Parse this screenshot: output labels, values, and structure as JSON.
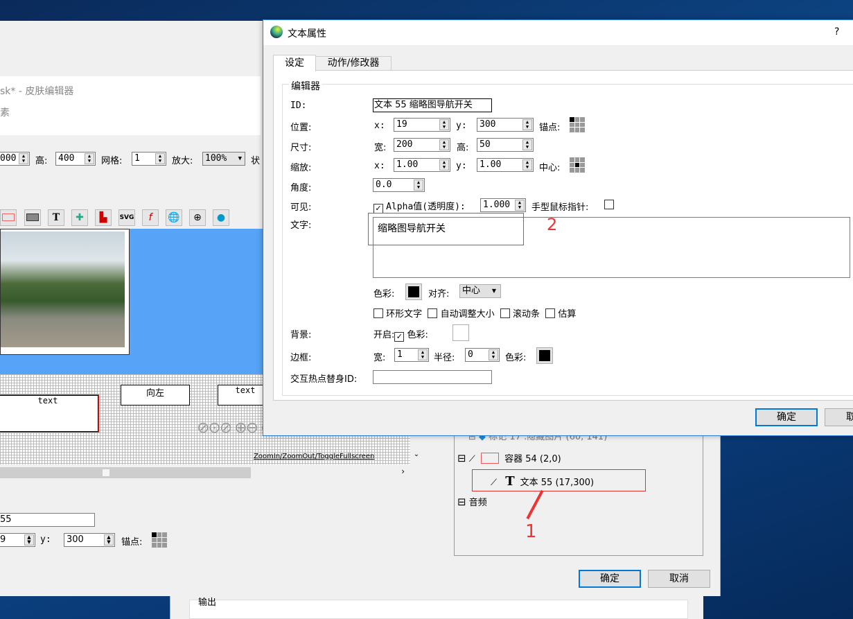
{
  "editor": {
    "title": "sk* - 皮肤编辑器",
    "subtitle": "素",
    "toolbar": {
      "width_value": "000",
      "height_label": "高:",
      "height_value": "400",
      "grid_label": "网格:",
      "grid_value": "1",
      "zoom_label": "放大:",
      "zoom_value": "100%",
      "status_label": "状"
    },
    "tool_icons": [
      "rectangle-icon",
      "filled-rectangle-icon",
      "text-icon",
      "image-button-icon",
      "image-icon",
      "svg-icon",
      "flash-icon",
      "globe-icon",
      "crosshair-icon",
      "map-pin-icon"
    ],
    "tool_text_icon": "T",
    "canvas": {
      "text_box_1": "text",
      "button_left": "向左",
      "text_box_2": "text",
      "footer_text": "ZoomIn/ZoomOut/ToggleFullscreen"
    },
    "lower": {
      "id_value": "55",
      "x_value": "9",
      "y_label": "y:",
      "y_value": "300",
      "anchor_label": "锚点:"
    },
    "tree": {
      "items": [
        {
          "label": "标记 17 :隐藏图片 (60, 141)"
        },
        {
          "label": "容器 54 (2,0)"
        },
        {
          "label": "文本 55 (17,300)"
        },
        {
          "label": "音频"
        }
      ]
    },
    "ok": "确定",
    "cancel": "取消",
    "output_label": "输出",
    "annotation_1": "1"
  },
  "dialog": {
    "title": "文本属性",
    "help": "?",
    "tabs": [
      {
        "label": "设定"
      },
      {
        "label": "动作/修改器"
      }
    ],
    "group": "编辑器",
    "id_label": "ID:",
    "id_value": "文本 55 缩略图导航开关",
    "pos_label": "位置:",
    "x_label": "x:",
    "x_value": "19",
    "y_label": "y:",
    "y_value": "300",
    "anchor_label": "锚点:",
    "size_label": "尺寸:",
    "w_label": "宽:",
    "w_value": "200",
    "h_label": "高:",
    "h_value": "50",
    "scale_label": "缩放:",
    "sx_value": "1.00",
    "sy_value": "1.00",
    "center_label": "中心:",
    "angle_label": "角度:",
    "angle_value": "0.0",
    "visible_label": "可见:",
    "alpha_label": "Alpha值(透明度):",
    "alpha_value": "1.000",
    "hand_label": "手型鼠标指针:",
    "visible_checked": true,
    "hand_checked": false,
    "text_label": "文字:",
    "text_value": "缩略图导航开关",
    "annotation_2": "2",
    "color_label": "色彩:",
    "text_color": "#000000",
    "align_label": "对齐:",
    "align_value": "中心",
    "options": [
      {
        "label": "环形文字",
        "checked": false
      },
      {
        "label": "自动调整大小",
        "checked": false
      },
      {
        "label": "滚动条",
        "checked": false
      },
      {
        "label": "估算",
        "checked": false
      }
    ],
    "bg_label": "背景:",
    "bg_enable_label": "开启:",
    "bg_enabled": true,
    "bg_color_label": "色彩:",
    "bg_color": "#ffffff",
    "border_label": "边框:",
    "border_w_label": "宽:",
    "border_w_value": "1",
    "radius_label": "半径:",
    "radius_value": "0",
    "border_color_label": "色彩:",
    "border_color": "#000000",
    "hotspot_label": "交互热点替身ID:",
    "hotspot_value": "",
    "ok": "确定",
    "cancel": "取"
  }
}
